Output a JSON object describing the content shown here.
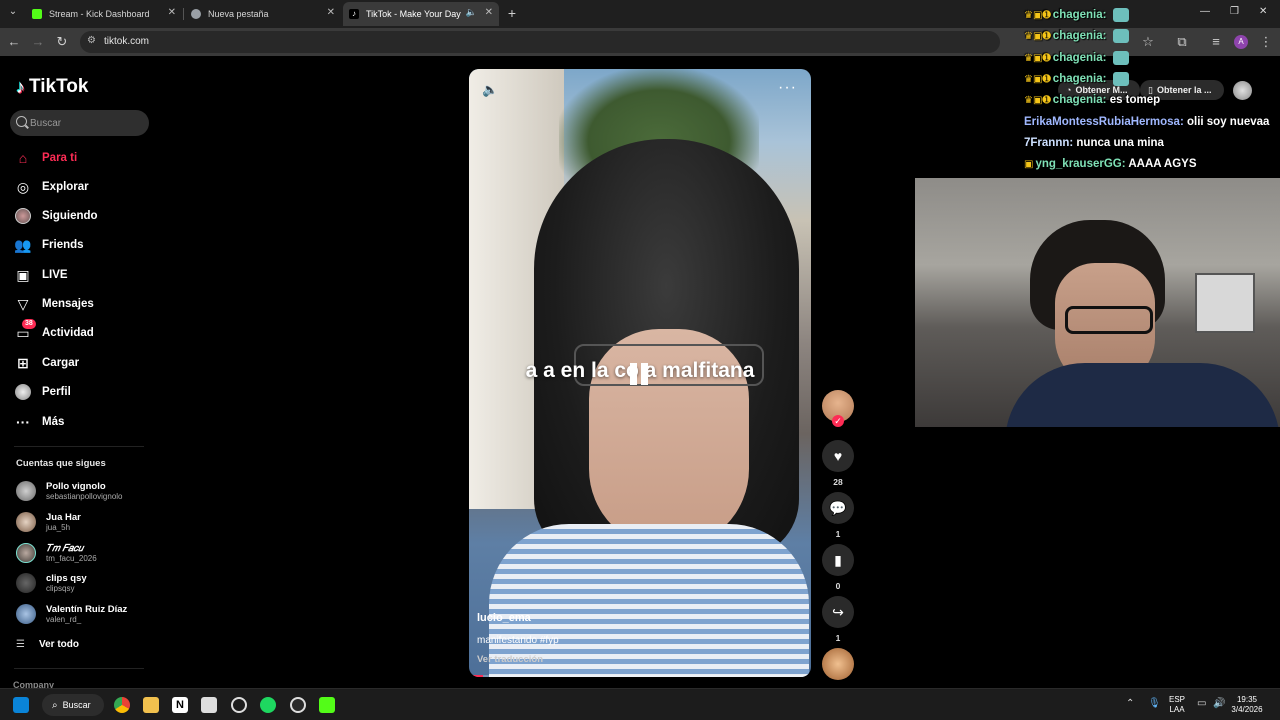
{
  "browser": {
    "tabs": [
      {
        "label": "Stream - Kick Dashboard",
        "favicon_color": "#53fc18"
      },
      {
        "label": "Nueva pestaña",
        "favicon_color": "#9aa0a6"
      },
      {
        "label": "TikTok - Make Your Day",
        "favicon_color": "#000000"
      }
    ],
    "active_tab": 2,
    "url": "tiktok.com",
    "profile_initial": "A"
  },
  "sidebar": {
    "logo": "TikTok",
    "search_placeholder": "Buscar",
    "nav": [
      {
        "label": "Para ti",
        "icon": "home-icon"
      },
      {
        "label": "Explorar",
        "icon": "compass-icon"
      },
      {
        "label": "Siguiendo",
        "icon": "following-avatar-icon"
      },
      {
        "label": "Friends",
        "icon": "friends-icon"
      },
      {
        "label": "LIVE",
        "icon": "live-icon"
      },
      {
        "label": "Mensajes",
        "icon": "send-icon"
      },
      {
        "label": "Actividad",
        "icon": "activity-icon",
        "badge": "38"
      },
      {
        "label": "Cargar",
        "icon": "upload-icon"
      },
      {
        "label": "Perfil",
        "icon": "profile-avatar-icon"
      },
      {
        "label": "Más",
        "icon": "more-icon"
      }
    ],
    "following_title": "Cuentas que sigues",
    "following": [
      {
        "name": "Pollo vignolo",
        "username": "sebastianpollovignolo"
      },
      {
        "name": "Jua Har",
        "username": "jua_5h"
      },
      {
        "name": "𝑇𝑚 𝐹𝑎𝑐𝑢",
        "username": "tm_facu_2026"
      },
      {
        "name": "clips qsy",
        "username": "clipsqsy"
      },
      {
        "name": "Valentín Ruiz Díaz",
        "username": "valen_rd_"
      }
    ],
    "see_all": "Ver todo",
    "company": "Company"
  },
  "video": {
    "caption_overlay": "a  a en la co  a malfitana",
    "author": "lucio_ema",
    "description": "manifestando #fyp",
    "translate": "Ver traducción",
    "likes": "28",
    "comments": "1",
    "saves": "0",
    "shares": "1"
  },
  "extension_chips": {
    "left": "Obtener M...",
    "right": "Obtener la ..."
  },
  "chat": [
    {
      "user": "chagenia:",
      "msg": "",
      "emote": true
    },
    {
      "user": "chagenia:",
      "msg": "",
      "emote": true
    },
    {
      "user": "chagenia:",
      "msg": "",
      "emote": true
    },
    {
      "user": "chagenia:",
      "msg": "",
      "emote": true
    },
    {
      "user": "chagenia:",
      "msg": "es tomep",
      "emote": false
    },
    {
      "user": "ErikaMontessRubiaHermosa:",
      "msg": "olii soy nuevaa",
      "emote": false
    },
    {
      "user": "7Frannn:",
      "msg": "nunca una mina",
      "emote": false
    },
    {
      "user": "yng_krauserGG:",
      "msg": "AAAA AGYS",
      "emote": false
    }
  ],
  "taskbar": {
    "search": "Buscar",
    "lang_top": "ESP",
    "lang_bottom": "LAA",
    "time": "19:35",
    "date": "3/4/2026"
  },
  "colors": {
    "accent": "#fe2c55",
    "chrome_bg": "#1f1f1f",
    "toolbar_bg": "#3a3a3a"
  }
}
